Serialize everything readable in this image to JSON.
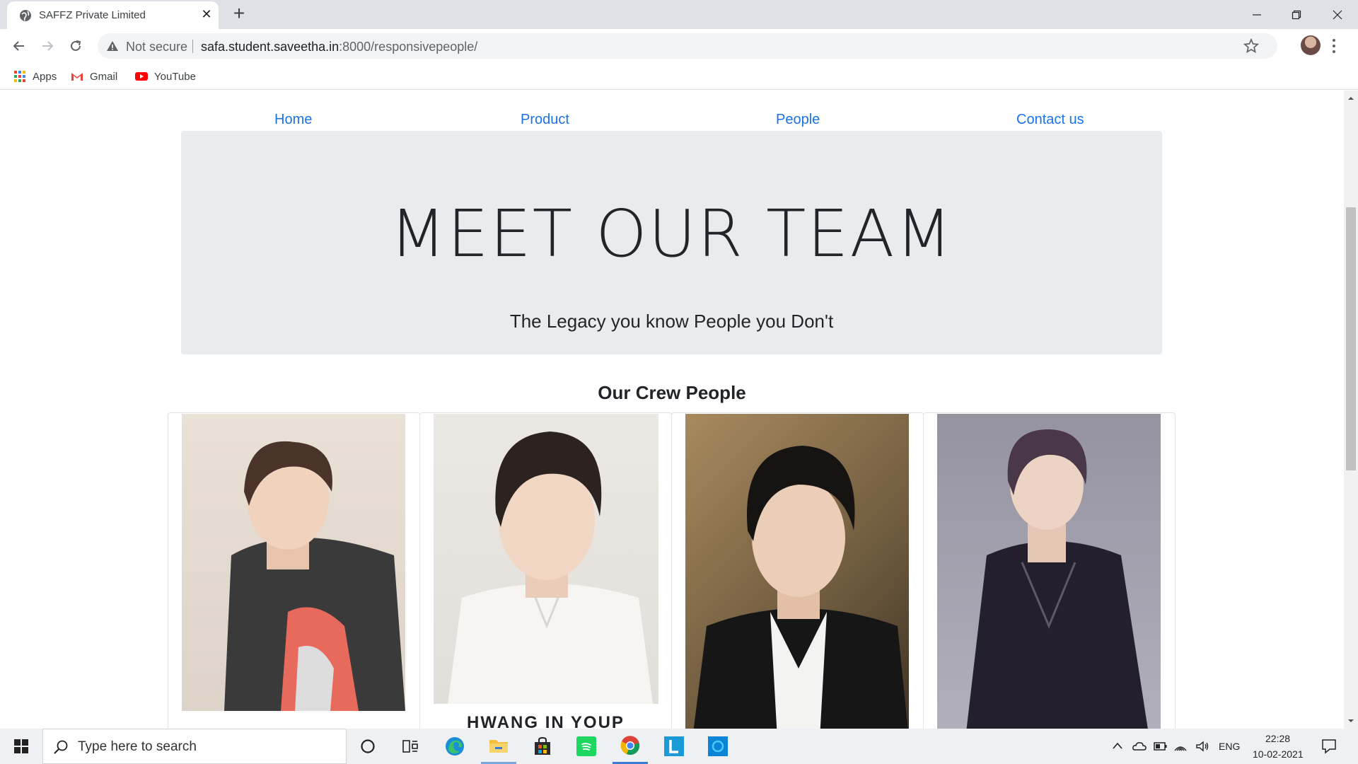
{
  "browser": {
    "tab_title": "SAFFZ Private Limited",
    "security_label": "Not secure",
    "url_host": "safa.student.saveetha.in",
    "url_rest": ":8000/responsivepeople/",
    "bookmarks": [
      {
        "label": "Apps",
        "icon": "apps-grid-icon"
      },
      {
        "label": "Gmail",
        "icon": "gmail-icon"
      },
      {
        "label": "YouTube",
        "icon": "youtube-icon"
      }
    ]
  },
  "site": {
    "nav": [
      "Home",
      "Product",
      "People",
      "Contact us"
    ],
    "hero_title": "MEET OUR TEAM",
    "hero_subtitle": "The Legacy you know People you Don't",
    "section_title": "Our Crew People",
    "cards": [
      {
        "photo": "person-1-photo"
      },
      {
        "photo": "person-2-photo",
        "name": "HWANG IN YOUP"
      },
      {
        "photo": "person-3-photo"
      },
      {
        "photo": "person-4-photo"
      }
    ]
  },
  "taskbar": {
    "search_placeholder": "Type here to search",
    "language": "ENG",
    "time": "22:28",
    "date": "10-02-2021"
  },
  "colors": {
    "link": "#1a73e8",
    "jumbotron_bg": "#e9ecef",
    "taskbar_bg": "#eef0f4"
  }
}
